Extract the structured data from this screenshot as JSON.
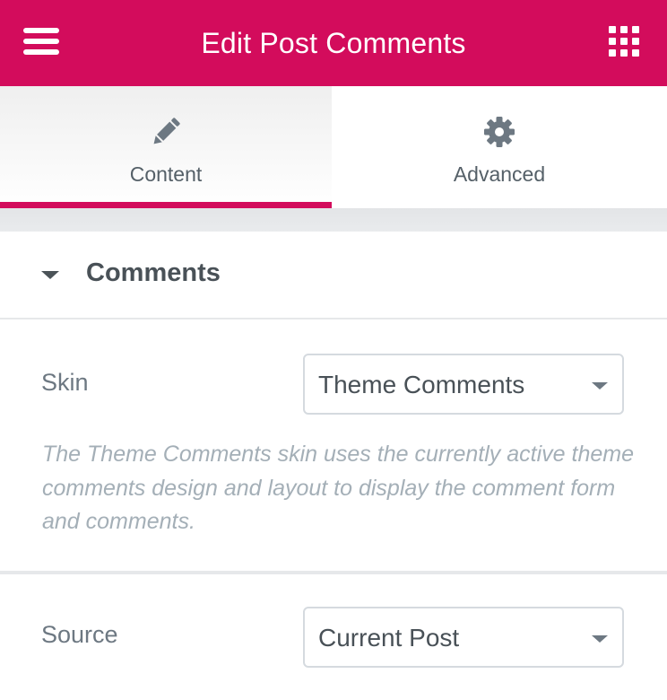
{
  "header": {
    "title": "Edit Post Comments",
    "menu_icon": "hamburger-icon",
    "apps_icon": "grid-icon"
  },
  "tabs": [
    {
      "label": "Content",
      "icon": "pencil-icon",
      "active": true
    },
    {
      "label": "Advanced",
      "icon": "gear-icon",
      "active": false
    }
  ],
  "section": {
    "title": "Comments",
    "expanded": true
  },
  "controls": {
    "skin": {
      "label": "Skin",
      "value": "Theme Comments",
      "description": "The Theme Comments skin uses the currently active theme comments design and layout to display the comment form and comments."
    },
    "source": {
      "label": "Source",
      "value": "Current Post"
    }
  },
  "colors": {
    "accent": "#d30c5c",
    "text": "#6d7882",
    "heading": "#495157",
    "muted": "#a4afb7",
    "border": "#d5dadf"
  }
}
